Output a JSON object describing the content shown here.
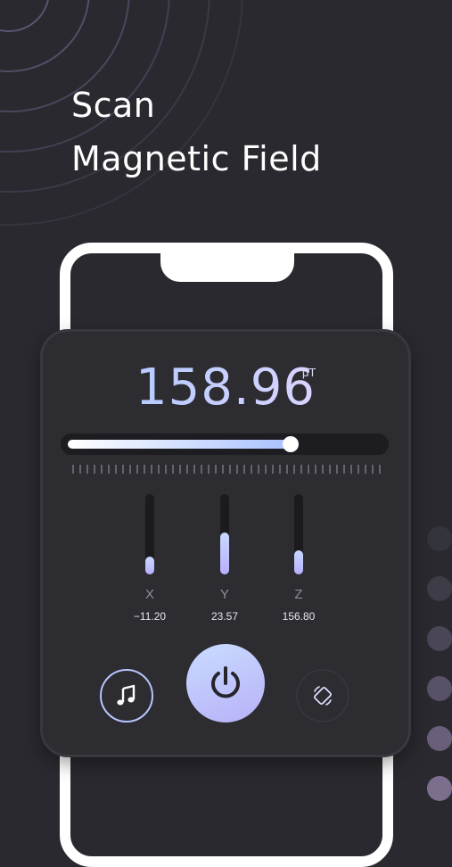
{
  "headline": {
    "line1": "Scan",
    "line2": "Magnetic Field"
  },
  "meter": {
    "value": "158.96",
    "unit": "μT",
    "level_fraction": 0.71
  },
  "axes": [
    {
      "label": "X",
      "value": "−11.20",
      "level_fraction": 0.22
    },
    {
      "label": "Y",
      "value": "23.57",
      "level_fraction": 0.52
    },
    {
      "label": "Z",
      "value": "156.80",
      "level_fraction": 0.3
    }
  ],
  "controls": {
    "sound_icon": "music-note-icon",
    "power_icon": "power-icon",
    "rotate_icon": "rotate-screen-icon"
  },
  "colors": {
    "background": "#2a292f",
    "panel": "#2c2c31",
    "accent_start": "#c9dcff",
    "accent_end": "#b7b1f8",
    "text": "#ffffff"
  }
}
